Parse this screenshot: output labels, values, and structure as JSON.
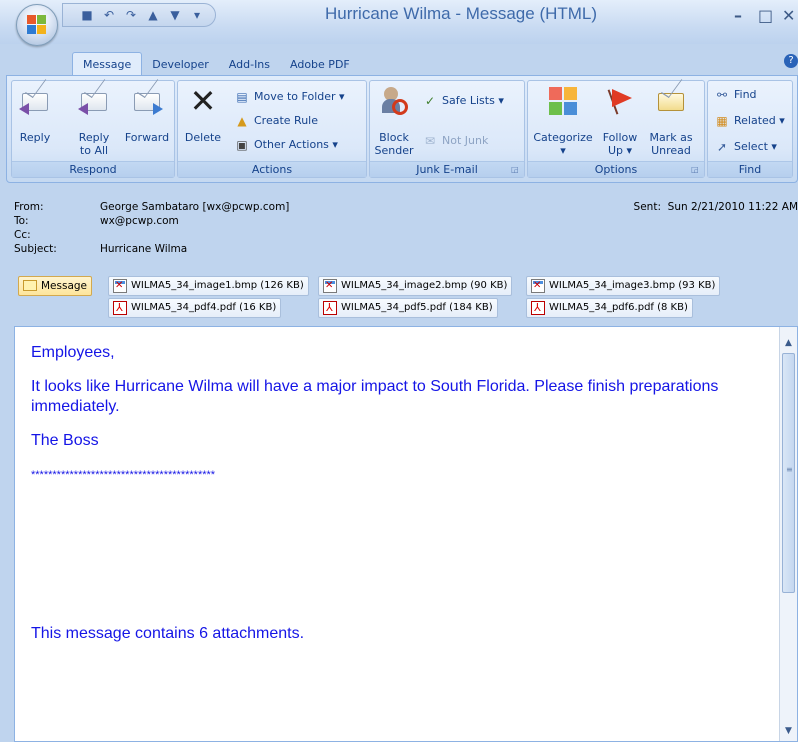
{
  "window": {
    "title": "Hurricane Wilma - Message (HTML)",
    "min": "–",
    "max": "□",
    "close": "✕"
  },
  "qat": {
    "save": "■",
    "undo": "↶",
    "redo": "↷",
    "prev": "▲",
    "next": "▼",
    "more": "▾"
  },
  "tabs": [
    "Message",
    "Developer",
    "Add-Ins",
    "Adobe PDF"
  ],
  "ribbon": {
    "respond": {
      "label": "Respond",
      "reply": "Reply",
      "reply_all_1": "Reply",
      "reply_all_2": "to All",
      "forward": "Forward"
    },
    "actions": {
      "label": "Actions",
      "delete": "Delete",
      "move_to_folder": "Move to Folder ▾",
      "create_rule": "Create Rule",
      "other_actions": "Other Actions ▾"
    },
    "junk": {
      "label": "Junk E-mail",
      "block_1": "Block",
      "block_2": "Sender",
      "safe_lists": "Safe Lists ▾",
      "not_junk": "Not Junk"
    },
    "options": {
      "label": "Options",
      "categorize": "Categorize",
      "categorize_arrow": "▾",
      "follow_1": "Follow",
      "follow_2": "Up ▾",
      "mark_1": "Mark as",
      "mark_2": "Unread"
    },
    "find": {
      "label": "Find",
      "find": "Find",
      "related": "Related ▾",
      "select": "Select ▾"
    }
  },
  "header": {
    "from_label": "From:",
    "from": "George Sambataro [wx@pcwp.com]",
    "to_label": "To:",
    "to": "wx@pcwp.com",
    "cc_label": "Cc:",
    "cc": "",
    "subject_label": "Subject:",
    "subject": "Hurricane Wilma",
    "sent_label": "Sent:",
    "sent": "Sun 2/21/2010 11:22 AM"
  },
  "attachments": {
    "message_tab": "Message",
    "files": [
      "WILMA5_34_image1.bmp (126 KB)",
      "WILMA5_34_image2.bmp (90 KB)",
      "WILMA5_34_image3.bmp (93 KB)",
      "WILMA5_34_pdf4.pdf (16 KB)",
      "WILMA5_34_pdf5.pdf (184 KB)",
      "WILMA5_34_pdf6.pdf (8 KB)"
    ]
  },
  "body": {
    "greeting": "Employees,",
    "paragraph": "It looks like Hurricane Wilma will have a major impact to South Florida.  Please finish preparations immediately.",
    "signature": "The Boss",
    "stars": "*******************************************",
    "attachment_note": "This message contains 6 attachments."
  },
  "colors": {
    "body_text": "#1515e6",
    "ribbon_text": "#15428b",
    "ribbon_bg": "#d1e1f6"
  }
}
